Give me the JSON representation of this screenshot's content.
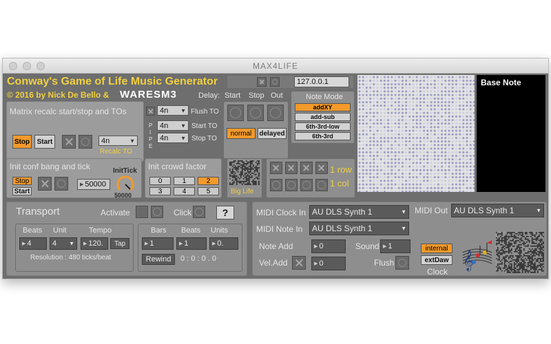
{
  "window": {
    "title": "MAX4LIFE"
  },
  "header": {
    "title": "Conway's Game of Life Music Generator",
    "credit": "© 2016 by Nick De Bello &",
    "brand": "WARESM3",
    "ip": "127.0.0.1"
  },
  "matrix": {
    "label": "Matrix recalc start/stop and TOs",
    "stop": "Stop",
    "start": "Start",
    "recalc_value": "4n",
    "recalc_label": "Recalc TO"
  },
  "pipe": {
    "letters": [
      "P",
      "I",
      "P",
      "E"
    ],
    "flush_value": "4n",
    "flush_label": "Flush TO",
    "start_value": "4n",
    "start_label": "Start TO",
    "stop_value": "4n",
    "stop_label": "Stop TO"
  },
  "delay": {
    "label": "Delay:",
    "start": "Start",
    "stop": "Stop",
    "out": "Out",
    "normal": "normal",
    "delayed": "delayed"
  },
  "note_mode": {
    "label": "Note Mode",
    "options": [
      "addXY",
      "add-sub",
      "6th-3rd-low",
      "6th-3rd"
    ],
    "selected": "addXY"
  },
  "base_note": {
    "label": "Base Note"
  },
  "init_conf": {
    "label": "Init conf bang and tick",
    "stop": "Stop",
    "start": "Start",
    "tick_value": "50000",
    "inittick_label": "InitTick",
    "dial_value": "50000"
  },
  "init_crowd": {
    "label": "Init crowd factor",
    "options": [
      "0",
      "1",
      "2",
      "3",
      "4",
      "5"
    ],
    "selected": "2",
    "big_life": "Big Life"
  },
  "row_col": {
    "row": "1 row",
    "col": "1 col"
  },
  "transport": {
    "title": "Transport",
    "activate": "Activate",
    "click": "Click",
    "help": "?",
    "beats_label": "Beats",
    "unit_label": "Unit",
    "tempo_label": "Tempo",
    "beats_value": "4",
    "unit_value": "4",
    "tempo_value": "120.",
    "tap": "Tap",
    "resolution": "Resolution : 480 ticks/beat",
    "bars_label": "Bars",
    "pos_beats_label": "Beats",
    "units_label": "Units",
    "bars_value": "1",
    "pos_beats_value": "1",
    "units_value": "0.",
    "rewind": "Rewind",
    "position": "0 : 0 : 0 . 0"
  },
  "midi": {
    "clock_in_label": "MIDI Clock In",
    "clock_in_value": "AU DLS Synth 1",
    "note_in_label": "MIDI Note In",
    "note_in_value": "AU DLS Synth 1",
    "out_label": "MIDI Out",
    "out_value": "AU DLS Synth 1",
    "note_add_label": "Note Add",
    "note_add_value": "0",
    "sound_label": "Sound",
    "sound_value": "1",
    "vel_add_label": "Vel.Add",
    "vel_add_value": "0",
    "flush_label": "Flush",
    "internal": "internal",
    "extdaw": "extDaw",
    "clock": "Clock"
  },
  "colors": {
    "accent_orange": "#f39a2a",
    "title_yellow": "#f0d040",
    "panel_gray": "#9c9c9c",
    "background": "#6e6e6e",
    "dot_color": "#8c8fb8"
  }
}
